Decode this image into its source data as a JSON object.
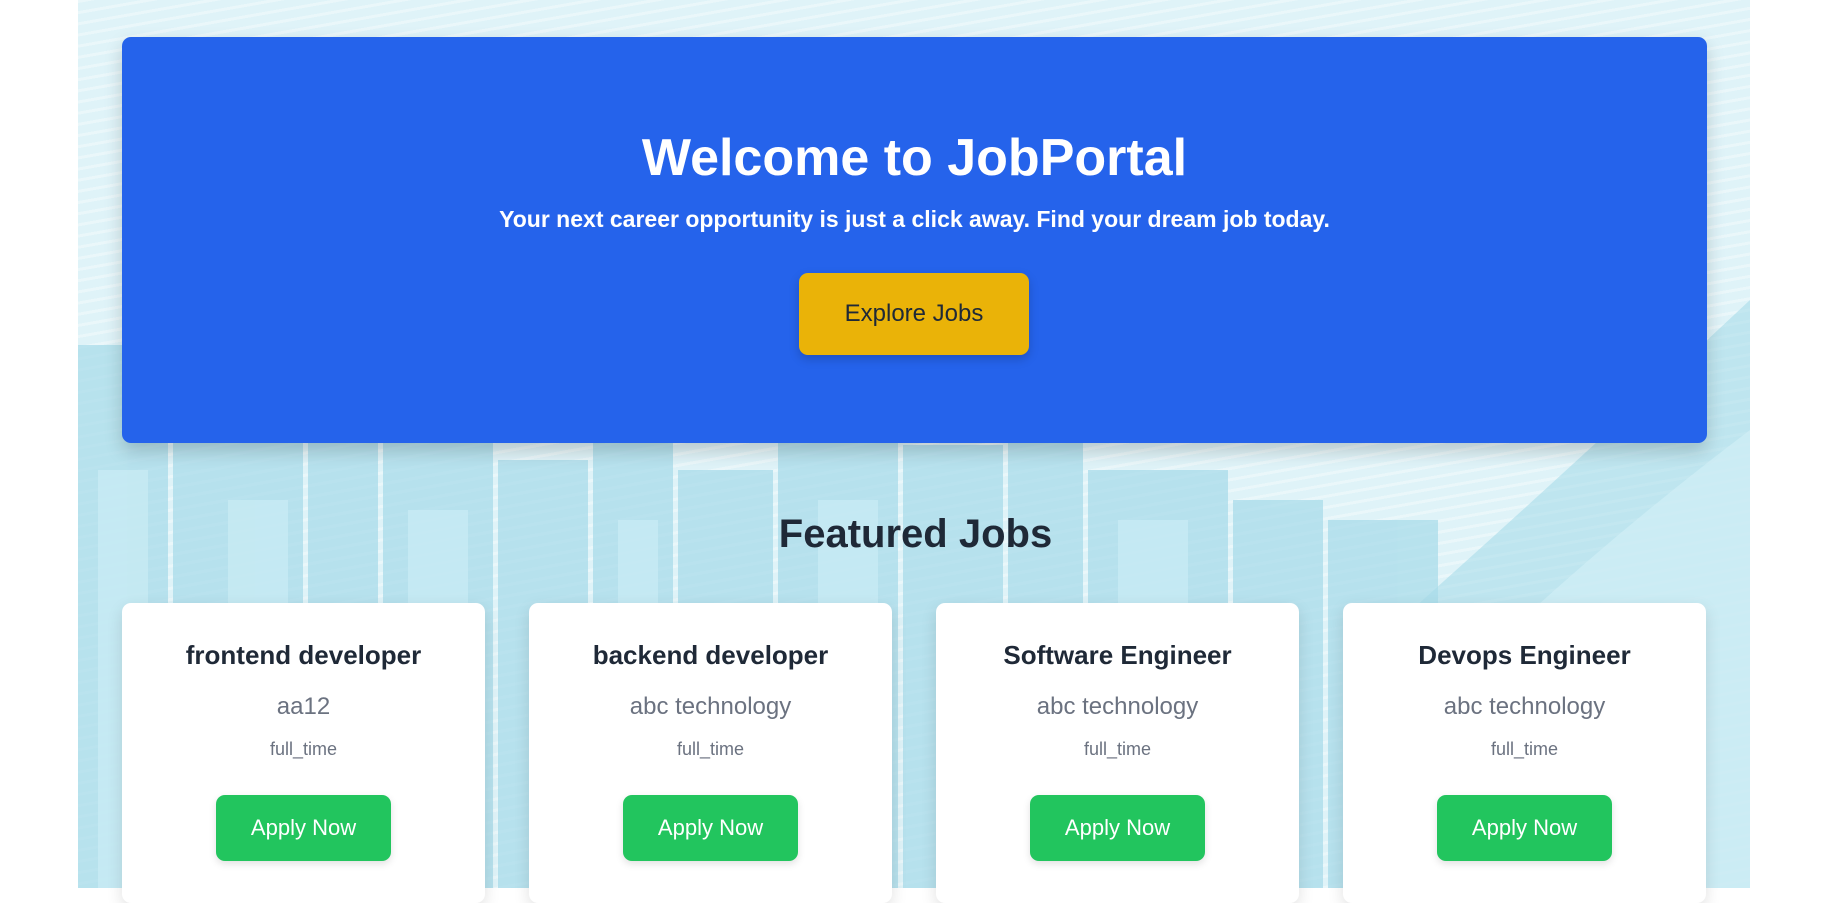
{
  "hero": {
    "title": "Welcome to JobPortal",
    "subtitle": "Your next career opportunity is just a click away. Find your dream job today.",
    "cta_label": "Explore Jobs"
  },
  "featured": {
    "title": "Featured Jobs",
    "jobs": [
      {
        "title": "frontend developer",
        "company": "aa12",
        "type": "full_time",
        "apply_label": "Apply Now"
      },
      {
        "title": "backend developer",
        "company": "abc technology",
        "type": "full_time",
        "apply_label": "Apply Now"
      },
      {
        "title": "Software Engineer",
        "company": "abc technology",
        "type": "full_time",
        "apply_label": "Apply Now"
      },
      {
        "title": "Devops Engineer",
        "company": "abc technology",
        "type": "full_time",
        "apply_label": "Apply Now"
      }
    ]
  },
  "colors": {
    "hero_bg": "#2563eb",
    "cta_bg": "#eab308",
    "apply_bg": "#22c55e",
    "page_bg": "#dff3f8"
  }
}
